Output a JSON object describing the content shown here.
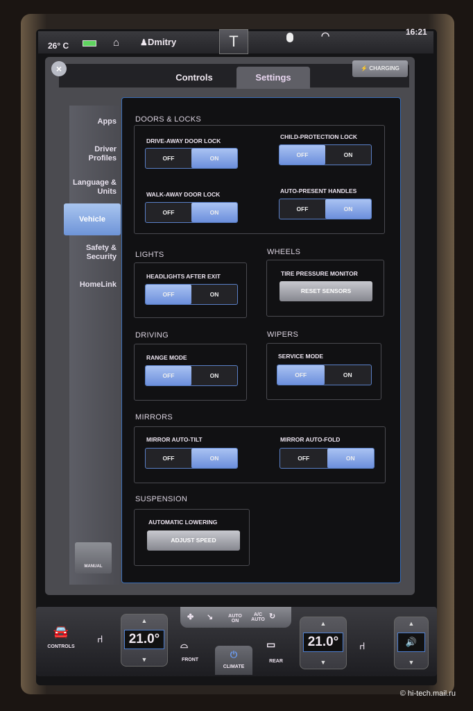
{
  "status_bar": {
    "temperature": "26° C",
    "user": "Dmitry",
    "time": "16:21"
  },
  "tabs": [
    {
      "label": "Controls",
      "active": false
    },
    {
      "label": "Settings",
      "active": true
    }
  ],
  "charging_label": "CHARGING",
  "sidebar": {
    "items": [
      {
        "label": "Apps"
      },
      {
        "label": "Driver Profiles"
      },
      {
        "label": "Language & Units"
      },
      {
        "label": "Vehicle",
        "active": true
      },
      {
        "label": "Safety & Security"
      },
      {
        "label": "HomeLink"
      }
    ],
    "manual_label": "MANUAL"
  },
  "toggle": {
    "off": "OFF",
    "on": "ON"
  },
  "sections": {
    "doors_locks": {
      "title": "DOORS & LOCKS",
      "drive_away": {
        "label": "DRIVE-AWAY DOOR LOCK",
        "value": "ON"
      },
      "child_protection": {
        "label": "CHILD-PROTECTION LOCK",
        "value": "OFF"
      },
      "walk_away": {
        "label": "WALK-AWAY DOOR LOCK",
        "value": "ON"
      },
      "auto_present": {
        "label": "AUTO-PRESENT HANDLES",
        "value": "ON"
      }
    },
    "lights": {
      "title": "LIGHTS",
      "headlights": {
        "label": "HEADLIGHTS AFTER EXIT",
        "value": "OFF"
      }
    },
    "wheels": {
      "title": "WHEELS",
      "tire": {
        "label": "TIRE PRESSURE MONITOR",
        "button": "RESET SENSORS"
      }
    },
    "driving": {
      "title": "DRIVING",
      "range": {
        "label": "RANGE MODE",
        "value": "OFF"
      }
    },
    "wipers": {
      "title": "WIPERS",
      "service": {
        "label": "SERVICE MODE",
        "value": "OFF"
      }
    },
    "mirrors": {
      "title": "MIRRORS",
      "tilt": {
        "label": "MIRROR AUTO-TILT",
        "value": "ON"
      },
      "fold": {
        "label": "MIRROR AUTO-FOLD",
        "value": "ON"
      }
    },
    "suspension": {
      "title": "SUSPENSION",
      "lowering": {
        "label": "AUTOMATIC LOWERING",
        "button": "ADJUST SPEED"
      }
    }
  },
  "climate": {
    "controls_label": "CONTROLS",
    "left_temp": "21.0°",
    "right_temp": "21.0°",
    "auto_on": "AUTO ON",
    "ac_auto": "A/C AUTO",
    "front": "FRONT",
    "rear": "REAR",
    "climate": "CLIMATE"
  },
  "watermark": "© hi-tech.mail.ru",
  "colors": {
    "accent": "#7b9ce0",
    "background": "#111113"
  }
}
